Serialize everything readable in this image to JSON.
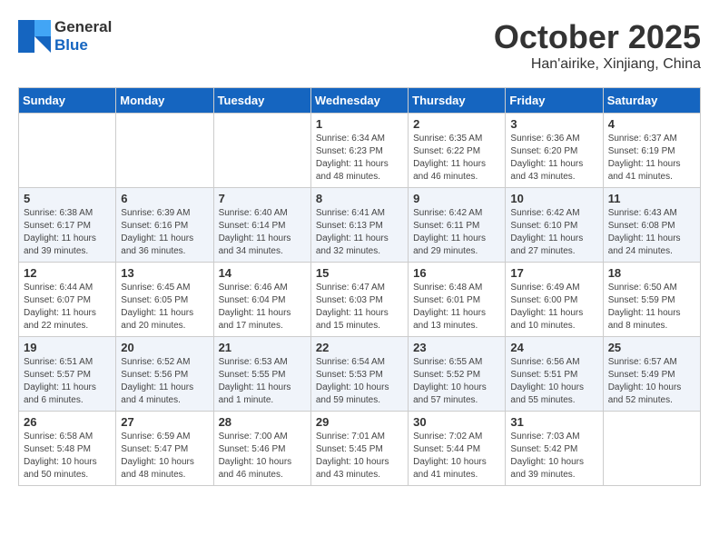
{
  "header": {
    "logo_general": "General",
    "logo_blue": "Blue",
    "month": "October 2025",
    "location": "Han'airike, Xinjiang, China"
  },
  "weekdays": [
    "Sunday",
    "Monday",
    "Tuesday",
    "Wednesday",
    "Thursday",
    "Friday",
    "Saturday"
  ],
  "weeks": [
    [
      {
        "day": "",
        "info": ""
      },
      {
        "day": "",
        "info": ""
      },
      {
        "day": "",
        "info": ""
      },
      {
        "day": "1",
        "info": "Sunrise: 6:34 AM\nSunset: 6:23 PM\nDaylight: 11 hours\nand 48 minutes."
      },
      {
        "day": "2",
        "info": "Sunrise: 6:35 AM\nSunset: 6:22 PM\nDaylight: 11 hours\nand 46 minutes."
      },
      {
        "day": "3",
        "info": "Sunrise: 6:36 AM\nSunset: 6:20 PM\nDaylight: 11 hours\nand 43 minutes."
      },
      {
        "day": "4",
        "info": "Sunrise: 6:37 AM\nSunset: 6:19 PM\nDaylight: 11 hours\nand 41 minutes."
      }
    ],
    [
      {
        "day": "5",
        "info": "Sunrise: 6:38 AM\nSunset: 6:17 PM\nDaylight: 11 hours\nand 39 minutes."
      },
      {
        "day": "6",
        "info": "Sunrise: 6:39 AM\nSunset: 6:16 PM\nDaylight: 11 hours\nand 36 minutes."
      },
      {
        "day": "7",
        "info": "Sunrise: 6:40 AM\nSunset: 6:14 PM\nDaylight: 11 hours\nand 34 minutes."
      },
      {
        "day": "8",
        "info": "Sunrise: 6:41 AM\nSunset: 6:13 PM\nDaylight: 11 hours\nand 32 minutes."
      },
      {
        "day": "9",
        "info": "Sunrise: 6:42 AM\nSunset: 6:11 PM\nDaylight: 11 hours\nand 29 minutes."
      },
      {
        "day": "10",
        "info": "Sunrise: 6:42 AM\nSunset: 6:10 PM\nDaylight: 11 hours\nand 27 minutes."
      },
      {
        "day": "11",
        "info": "Sunrise: 6:43 AM\nSunset: 6:08 PM\nDaylight: 11 hours\nand 24 minutes."
      }
    ],
    [
      {
        "day": "12",
        "info": "Sunrise: 6:44 AM\nSunset: 6:07 PM\nDaylight: 11 hours\nand 22 minutes."
      },
      {
        "day": "13",
        "info": "Sunrise: 6:45 AM\nSunset: 6:05 PM\nDaylight: 11 hours\nand 20 minutes."
      },
      {
        "day": "14",
        "info": "Sunrise: 6:46 AM\nSunset: 6:04 PM\nDaylight: 11 hours\nand 17 minutes."
      },
      {
        "day": "15",
        "info": "Sunrise: 6:47 AM\nSunset: 6:03 PM\nDaylight: 11 hours\nand 15 minutes."
      },
      {
        "day": "16",
        "info": "Sunrise: 6:48 AM\nSunset: 6:01 PM\nDaylight: 11 hours\nand 13 minutes."
      },
      {
        "day": "17",
        "info": "Sunrise: 6:49 AM\nSunset: 6:00 PM\nDaylight: 11 hours\nand 10 minutes."
      },
      {
        "day": "18",
        "info": "Sunrise: 6:50 AM\nSunset: 5:59 PM\nDaylight: 11 hours\nand 8 minutes."
      }
    ],
    [
      {
        "day": "19",
        "info": "Sunrise: 6:51 AM\nSunset: 5:57 PM\nDaylight: 11 hours\nand 6 minutes."
      },
      {
        "day": "20",
        "info": "Sunrise: 6:52 AM\nSunset: 5:56 PM\nDaylight: 11 hours\nand 4 minutes."
      },
      {
        "day": "21",
        "info": "Sunrise: 6:53 AM\nSunset: 5:55 PM\nDaylight: 11 hours\nand 1 minute."
      },
      {
        "day": "22",
        "info": "Sunrise: 6:54 AM\nSunset: 5:53 PM\nDaylight: 10 hours\nand 59 minutes."
      },
      {
        "day": "23",
        "info": "Sunrise: 6:55 AM\nSunset: 5:52 PM\nDaylight: 10 hours\nand 57 minutes."
      },
      {
        "day": "24",
        "info": "Sunrise: 6:56 AM\nSunset: 5:51 PM\nDaylight: 10 hours\nand 55 minutes."
      },
      {
        "day": "25",
        "info": "Sunrise: 6:57 AM\nSunset: 5:49 PM\nDaylight: 10 hours\nand 52 minutes."
      }
    ],
    [
      {
        "day": "26",
        "info": "Sunrise: 6:58 AM\nSunset: 5:48 PM\nDaylight: 10 hours\nand 50 minutes."
      },
      {
        "day": "27",
        "info": "Sunrise: 6:59 AM\nSunset: 5:47 PM\nDaylight: 10 hours\nand 48 minutes."
      },
      {
        "day": "28",
        "info": "Sunrise: 7:00 AM\nSunset: 5:46 PM\nDaylight: 10 hours\nand 46 minutes."
      },
      {
        "day": "29",
        "info": "Sunrise: 7:01 AM\nSunset: 5:45 PM\nDaylight: 10 hours\nand 43 minutes."
      },
      {
        "day": "30",
        "info": "Sunrise: 7:02 AM\nSunset: 5:44 PM\nDaylight: 10 hours\nand 41 minutes."
      },
      {
        "day": "31",
        "info": "Sunrise: 7:03 AM\nSunset: 5:42 PM\nDaylight: 10 hours\nand 39 minutes."
      },
      {
        "day": "",
        "info": ""
      }
    ]
  ]
}
